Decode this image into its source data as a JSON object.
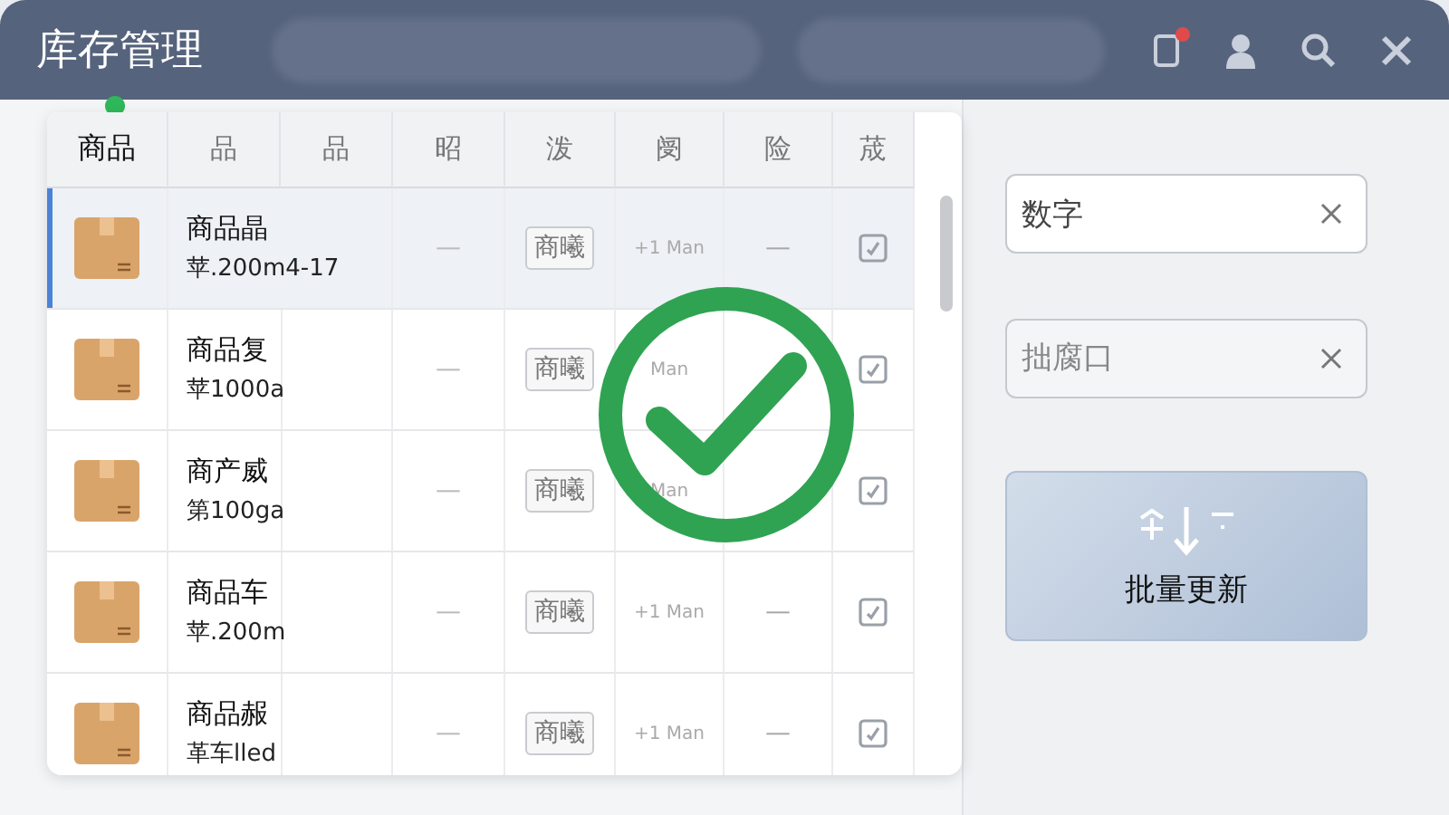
{
  "app": {
    "title": "库存管理",
    "alert": true
  },
  "table": {
    "columns": [
      "商品",
      "品",
      "品",
      "昭",
      "泼",
      "阌",
      "险",
      "荿"
    ],
    "rows": [
      {
        "name": "商品晶",
        "sub": "苹.200m4-17",
        "dash": "—",
        "tag": "商曦",
        "change": "+1 Man",
        "dash2": "—",
        "checked": true,
        "selected": true
      },
      {
        "name": "商品复",
        "sub": "苹1000a",
        "dash": "—",
        "tag": "商曦",
        "change": "Man",
        "checked": true,
        "selected": false
      },
      {
        "name": "商产威",
        "sub": "第100ga",
        "dash": "—",
        "tag": "商曦",
        "change": "Man",
        "checked": true,
        "selected": false
      },
      {
        "name": "商品车",
        "sub": "苹.200m",
        "dash": "—",
        "tag": "商曦",
        "change": "+1 Man",
        "dash2": "—",
        "checked": true,
        "selected": false
      },
      {
        "name": "商品赧",
        "sub": "革车lled",
        "dash": "—",
        "tag": "商曦",
        "change": "+1 Man",
        "dash2": "—",
        "checked": true,
        "selected": false
      }
    ]
  },
  "panel": {
    "fields": [
      {
        "value": "数字"
      },
      {
        "placeholder": "拙腐口"
      }
    ],
    "button": "批量更新"
  },
  "overlay": {
    "kind": "success"
  }
}
